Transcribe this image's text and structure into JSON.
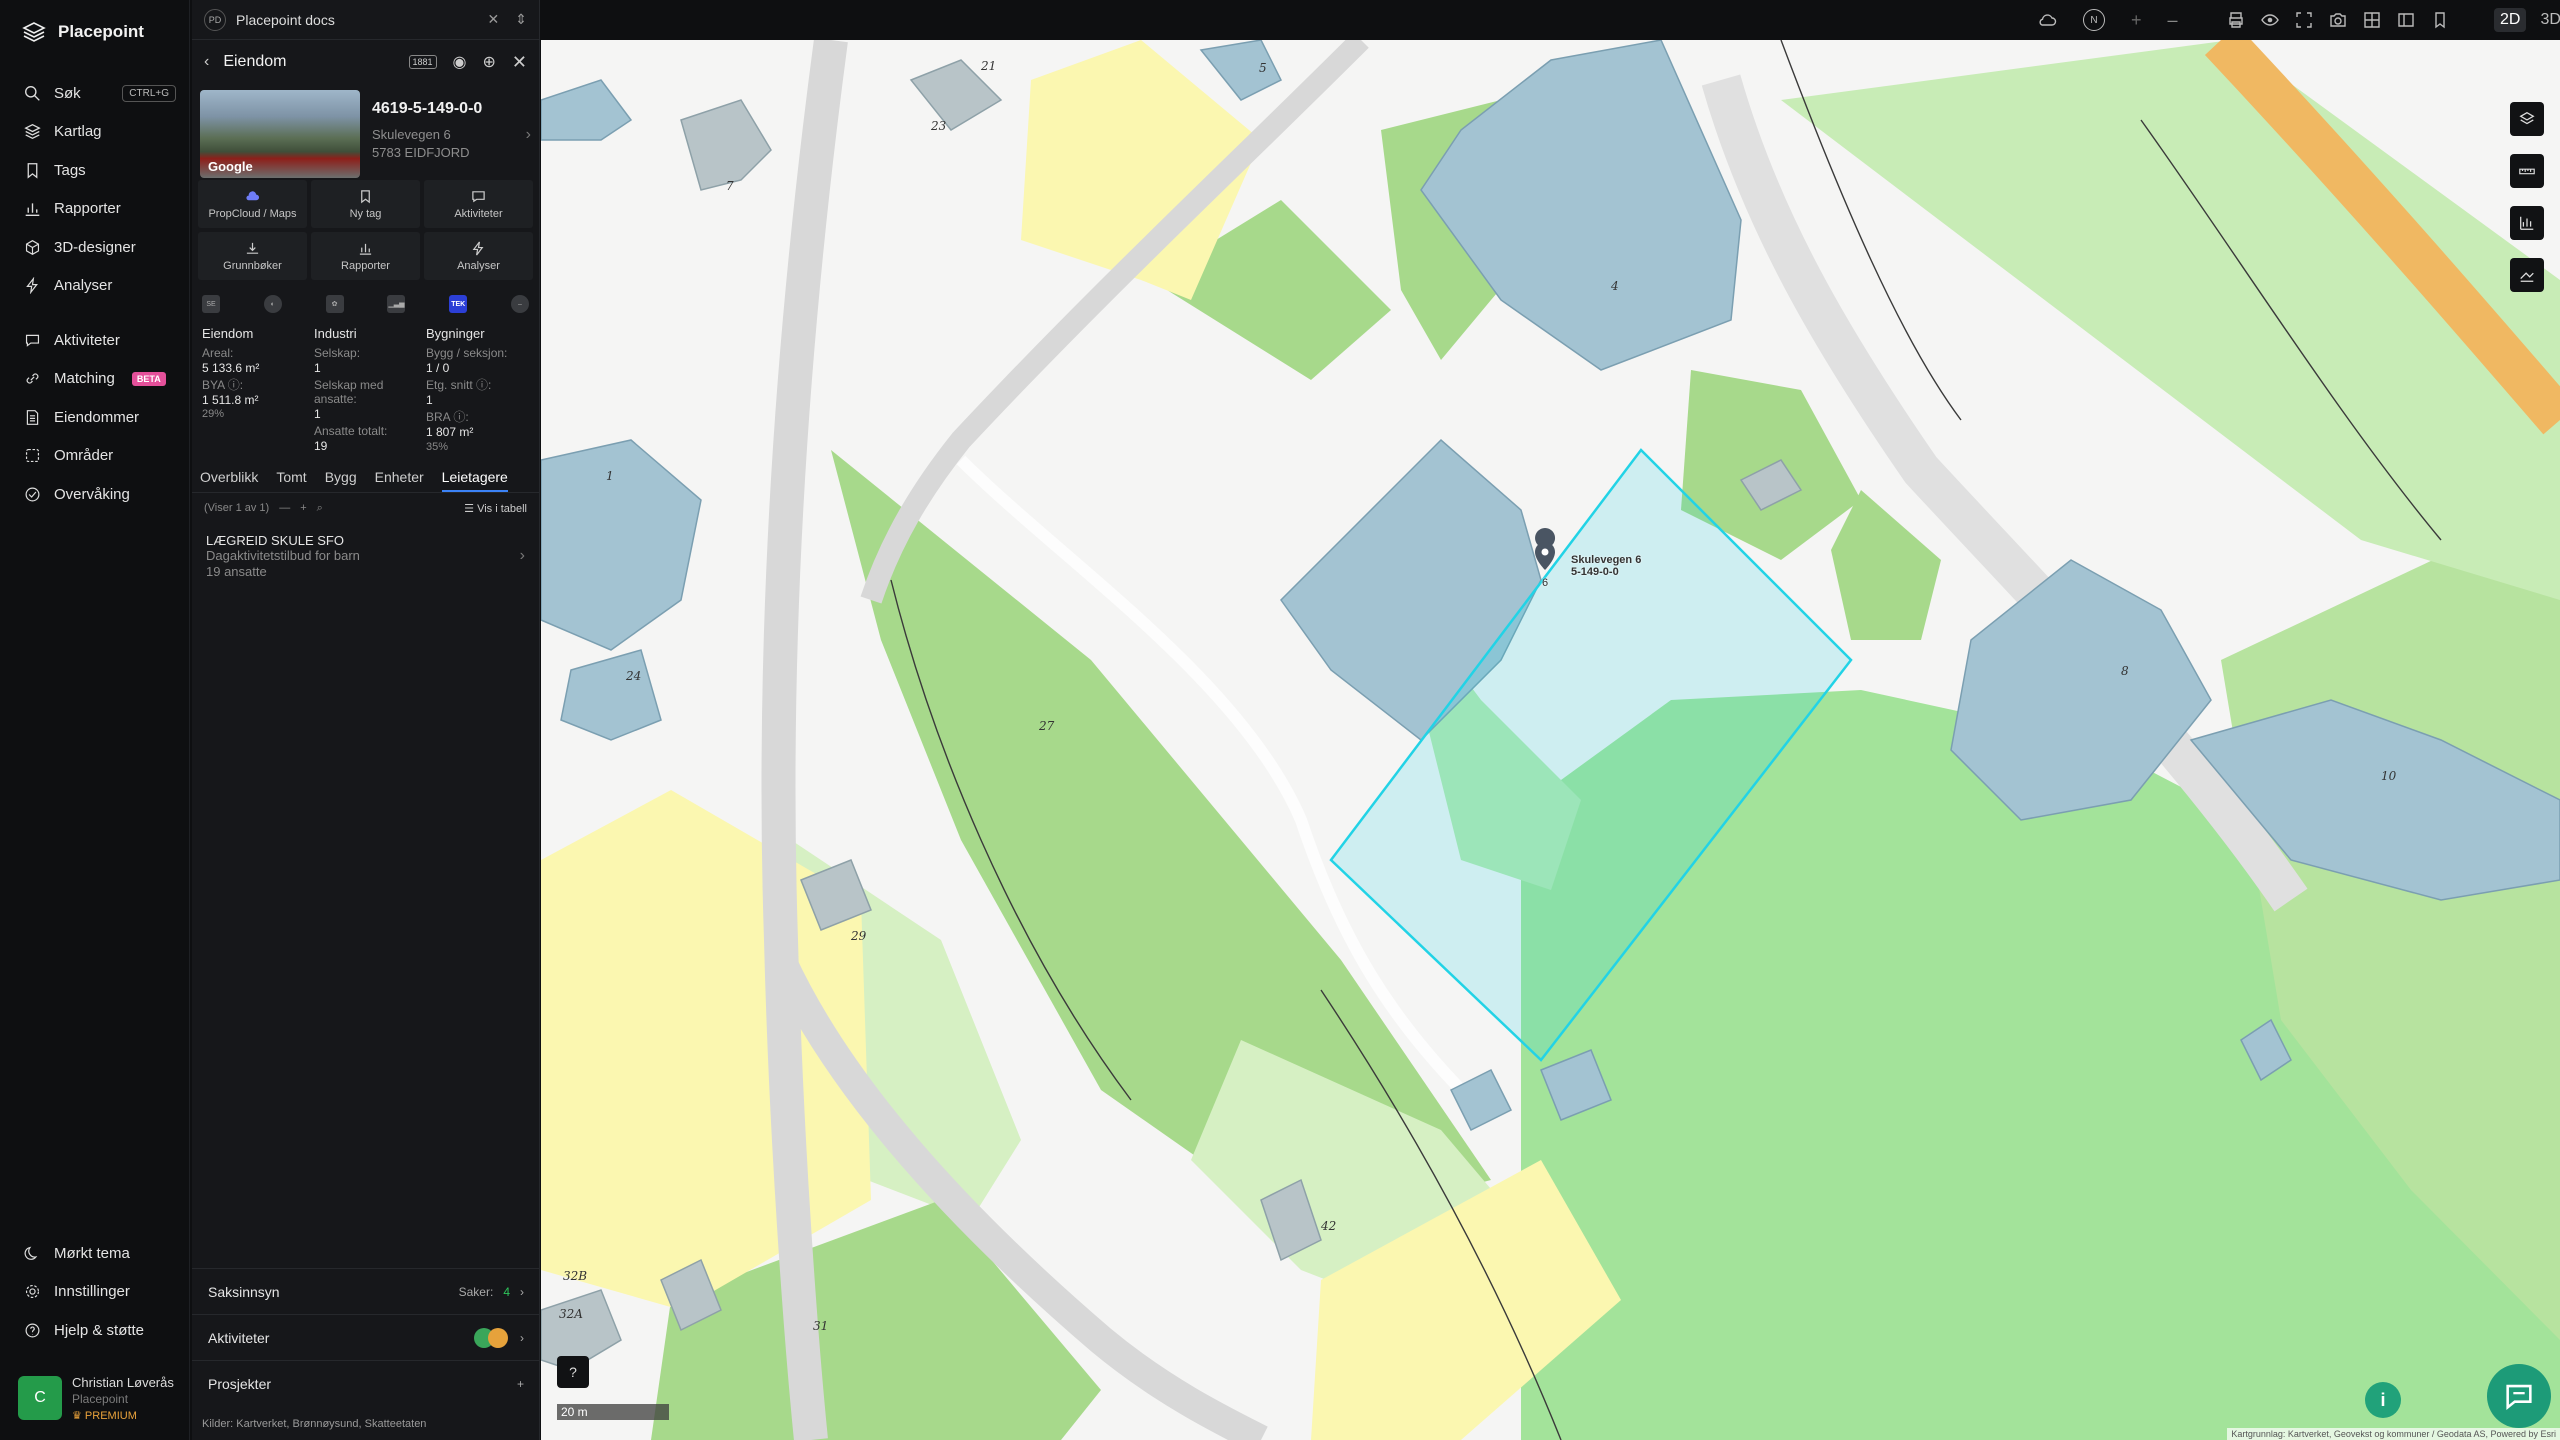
{
  "app": {
    "name": "Placepoint"
  },
  "nav": {
    "items": [
      {
        "label": "Søk",
        "shortcut": "CTRL+G",
        "icon": "search-icon"
      },
      {
        "label": "Kartlag",
        "icon": "layers-icon"
      },
      {
        "label": "Tags",
        "icon": "bookmark-icon"
      },
      {
        "label": "Rapporter",
        "icon": "bar-chart-icon"
      },
      {
        "label": "3D-designer",
        "icon": "cube-icon"
      },
      {
        "label": "Analyser",
        "icon": "bolt-icon"
      }
    ],
    "items2": [
      {
        "label": "Aktiviteter",
        "icon": "chat-icon"
      },
      {
        "label": "Matching",
        "badge": "BETA",
        "icon": "link-icon"
      },
      {
        "label": "Eiendommer",
        "icon": "document-icon"
      },
      {
        "label": "Områder",
        "icon": "area-icon"
      },
      {
        "label": "Overvåking",
        "icon": "monitor-icon"
      }
    ],
    "bottom": [
      {
        "label": "Mørkt tema",
        "icon": "moon-icon"
      },
      {
        "label": "Innstillinger",
        "icon": "gear-icon"
      },
      {
        "label": "Hjelp & støtte",
        "icon": "help-icon"
      }
    ],
    "user": {
      "initial": "C",
      "name": "Christian Løverås",
      "org": "Placepoint",
      "plan": "PREMIUM"
    }
  },
  "panel": {
    "doc_badge": "PD",
    "doc_title": "Placepoint docs",
    "title": "Eiendom",
    "tag_label": "1881",
    "property": {
      "id": "4619-5-149-0-0",
      "street": "Skulevegen 6",
      "postal": "5783 EIDFJORD",
      "photo_label": "Google"
    },
    "actions": [
      "PropCloud / Maps",
      "Ny tag",
      "Aktiviteter",
      "Grunnbøker",
      "Rapporter",
      "Analyser"
    ],
    "sources": [
      "SE",
      "",
      "",
      "",
      "TEK",
      ""
    ],
    "facts": {
      "eiendom": {
        "title": "Eiendom",
        "areal_label": "Areal:",
        "areal": "5 133.6 m²",
        "bya_label": "BYA ⓘ:",
        "bya": "1 511.8 m²",
        "bya_pct": "29%"
      },
      "industri": {
        "title": "Industri",
        "selskap_label": "Selskap:",
        "selskap": "1",
        "ansatte_label": "Selskap med ansatte:",
        "ansatte": "1",
        "total_label": "Ansatte totalt:",
        "total": "19"
      },
      "bygninger": {
        "title": "Bygninger",
        "bygg_label": "Bygg / seksjon:",
        "bygg": "1 / 0",
        "etg_label": "Etg. snitt ⓘ:",
        "etg": "1",
        "bra_label": "BRA ⓘ:",
        "bra": "1 807 m²",
        "bra_pct": "35%"
      }
    },
    "tabs": [
      "Overblikk",
      "Tomt",
      "Bygg",
      "Enheter",
      "Leietagere"
    ],
    "active_tab": "Leietagere",
    "list_info": "(Viser 1 av 1)",
    "table_link": "Vis i tabell",
    "tenant": {
      "name": "LÆGREID SKULE SFO",
      "type": "Dagaktivitetstilbud for barn",
      "employees": "19 ansatte"
    },
    "sections": {
      "saksinnsyn": "Saksinnsyn",
      "saker_label": "Saker:",
      "saker": "4",
      "aktiviteter": "Aktiviteter",
      "prosjekter": "Prosjekter"
    },
    "sources_footer": {
      "label": "Kilder:",
      "items": [
        "Kartverket,",
        "Brønnøysund,",
        "Skatteetaten"
      ]
    }
  },
  "map": {
    "modes": [
      "2D",
      "3D"
    ],
    "active_mode": "2D",
    "compass": "N",
    "scale_label": "20 m",
    "pin_label_1": "Skulevegen 6",
    "pin_label_2": "5-149-0-0",
    "pin_number": "6",
    "attribution": "Kartgrunnlag: Kartverket, Geovekst og kommuner / Geodata AS, Powered by Esri",
    "house_numbers": [
      "21",
      "5",
      "23",
      "7",
      "4",
      "1",
      "24",
      "27",
      "8",
      "10",
      "29",
      "42",
      "32B",
      "32A",
      "31"
    ],
    "accent": "#22d3e6"
  }
}
